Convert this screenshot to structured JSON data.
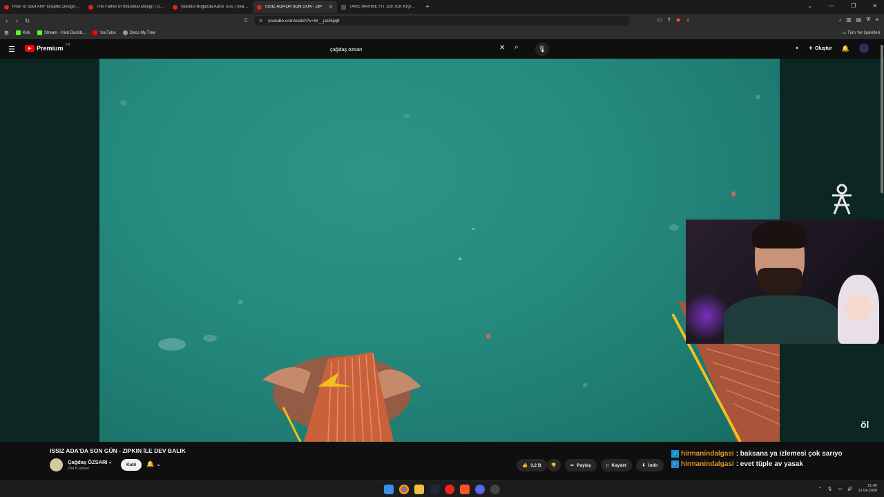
{
  "browser": {
    "tabs": [
      {
        "title": "How To Start ANY Graphic Design Fr",
        "active": false
      },
      {
        "title": "The Father of Industrial Design | Dier",
        "active": false
      },
      {
        "title": "İstanbul Boğazda Kano Turu | Sea Ka",
        "active": false
      },
      {
        "title": "ISSIZ ADA'DA SON GÜN - ZIP",
        "active": true
      },
      {
        "title": "TAHE MARINE FIT 158 TEK KİŞİLİK Sİ",
        "active": false
      }
    ],
    "url": "youtube.com/watch?v=W__jaG6jxj8",
    "bookmarks": [
      "Kick",
      "Stream - Kick Dashb...",
      "YouTube",
      "Deco My Tree"
    ],
    "bookmarks_right": "Tüm Yer İşaretleri"
  },
  "youtube": {
    "logo_text": "Premium",
    "logo_badge": "TR",
    "search_value": "çağdaş özsarı",
    "create_label": "Oluştur"
  },
  "video": {
    "title": "ISSIZ ADA'DA SON GÜN - ZIPKIN İLE DEV BALIK",
    "channel": "Çağdaş ÖZSARI",
    "subscribers": "294 B abone",
    "join_label": "Katıl",
    "likes": "3,2 B",
    "share_label": "Paylaş",
    "save_label": "Kaydet",
    "download_label": "İndir"
  },
  "chat": [
    {
      "user": "hirmanindalgasi",
      "message": "baksana ya izlemesi çok sarıyo"
    },
    {
      "user": "hirmanindalgasi",
      "message": "evet tüple av yasak"
    }
  ],
  "taskbar": {
    "time": "21:45",
    "date": "12.04.2026"
  },
  "colors": {
    "accent_red": "#ff0000",
    "water": "#268b7f",
    "chat_user": "#e89b2f"
  }
}
